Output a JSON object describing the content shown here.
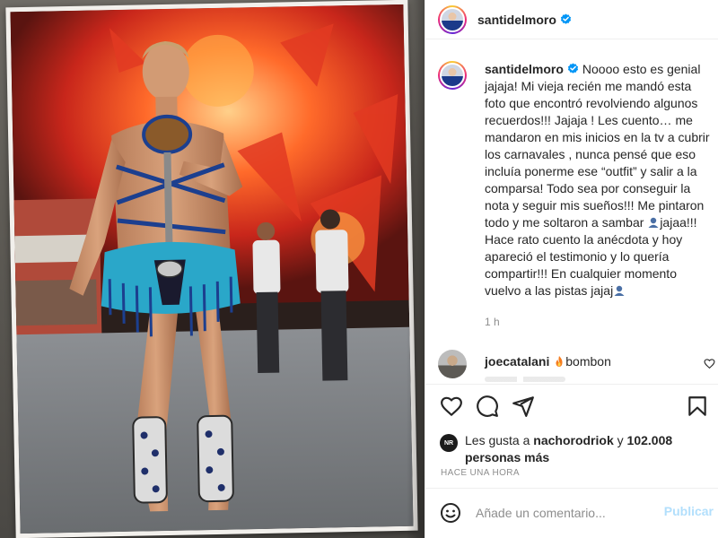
{
  "post": {
    "author": "santidelmoro",
    "caption": "Noooo esto es genial jajaja! Mi vieja recién me mandó esta foto que encontró revolviendo algunos recuerdos!!! Jajaja ! Les cuento… me mandaron en mis inicios en la tv a cubrir los carnavales , nunca pensé que eso incluía ponerme ese “outfit” y salir a la comparsa! Todo sea por conseguir la nota y seguir mis sueños!!! Me pintaron todo y me soltaron a sambar",
    "caption_mid": "jajaa!!! Hace rato cuento la anécdota y hoy apareció el testimonio y lo quería compartir!!! En cualquier momento vuelvo a las pistas jajaj",
    "time_ago": "1 h"
  },
  "comment": {
    "author": "joecatalani",
    "text": "bombon"
  },
  "likes": {
    "prefix": "Les gusta a",
    "user": "nachorodriok",
    "middle": "y",
    "count": "102.008",
    "suffix": "personas más",
    "badge": "NR"
  },
  "timestamp": "HACE UNA HORA",
  "compose": {
    "placeholder": "Añade un comentario...",
    "publish_label": "Publicar"
  },
  "colors": {
    "verified": "#0095f6",
    "publish": "#b2dffc",
    "secondary_text": "#8e8e8e"
  }
}
